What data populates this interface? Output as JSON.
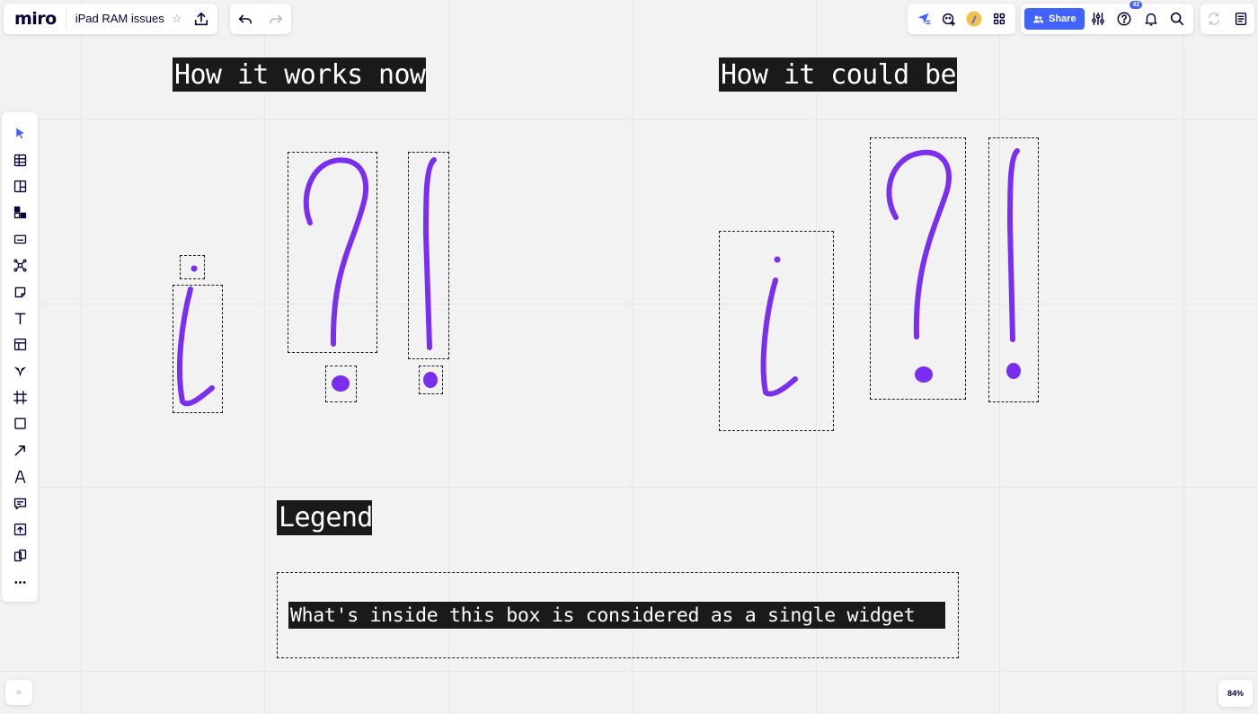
{
  "app": {
    "logo": "miro",
    "board_title": "iPad RAM issues",
    "star": "☆"
  },
  "topbar_right": {
    "share_label": "Share",
    "notification_badge": "42"
  },
  "left_toolbar": {
    "tools": [
      "select-tool",
      "table-tool",
      "kanban-tool",
      "shapes-library-tool",
      "card-tool",
      "mind-map-tool",
      "sticky-note-tool",
      "text-tool",
      "template-tool",
      "apps-tool",
      "frame-tool",
      "shape-tool",
      "connection-line-tool",
      "pen-tool",
      "comment-tool",
      "upload-tool",
      "screen-share-tool",
      "more-tools"
    ]
  },
  "board": {
    "heading_now": "How it works now",
    "heading_could_be": "How it could be",
    "legend_title": "Legend",
    "legend_text": "What's inside this box is considered as a single widget",
    "ink_color": "#7a2ff0"
  },
  "footer": {
    "zoom": "84%",
    "expand": "»"
  }
}
